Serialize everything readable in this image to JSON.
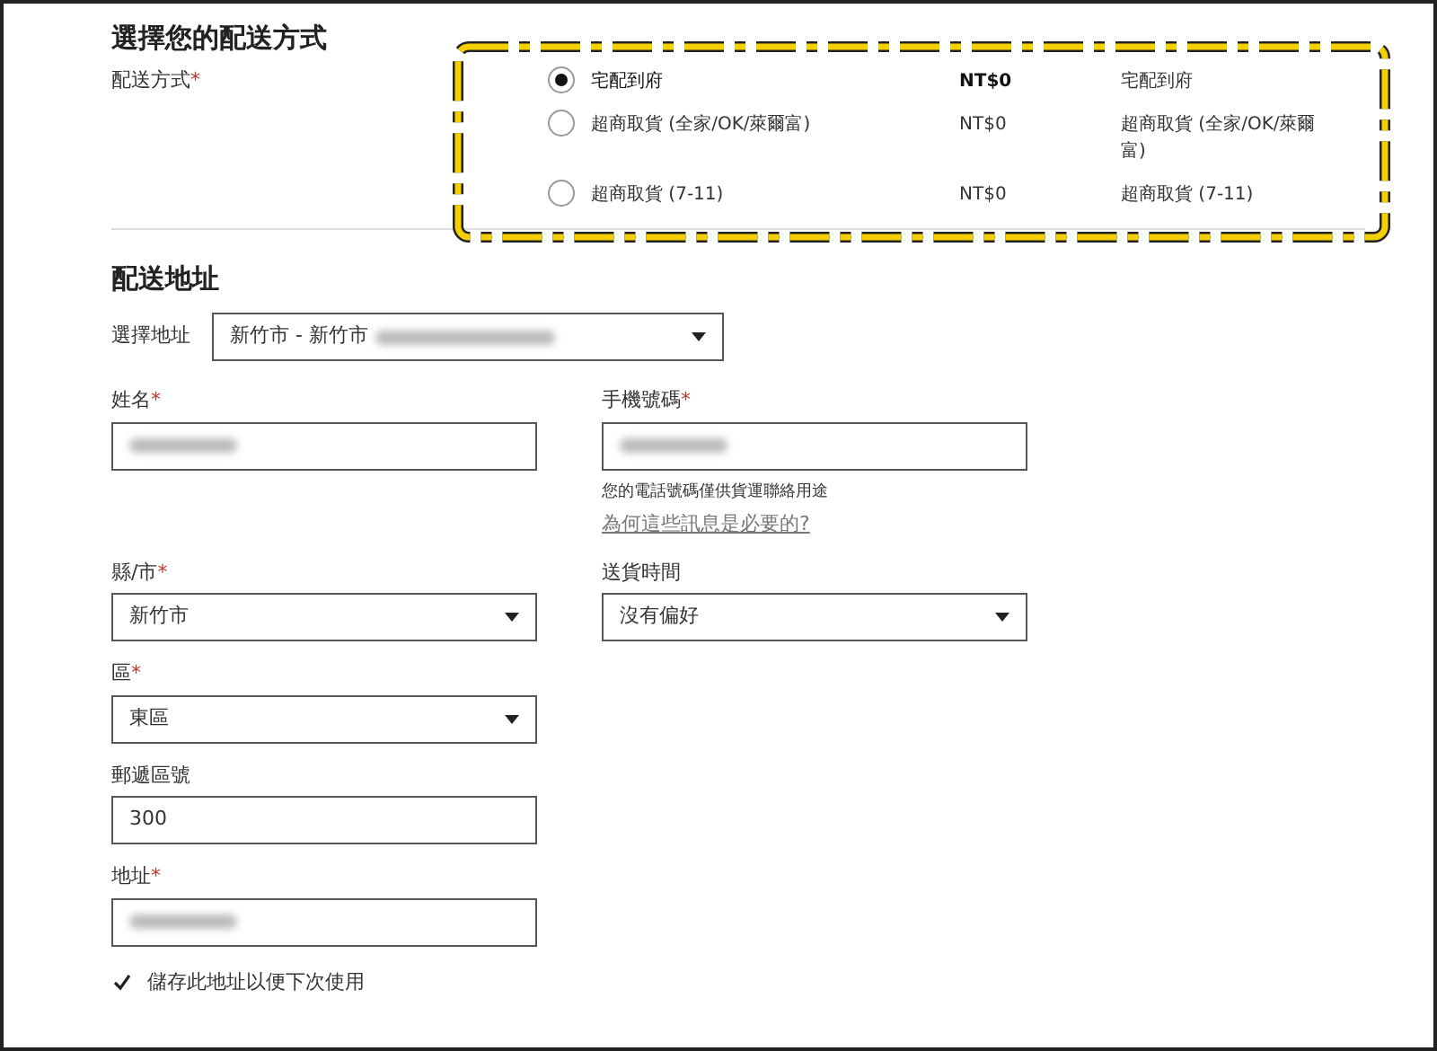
{
  "required_mark": "*",
  "shipping_method": {
    "title": "選擇您的配送方式",
    "label": "配送方式",
    "required": true,
    "options": [
      {
        "name": "宅配到府",
        "price": "NT$0",
        "description": "宅配到府",
        "selected": true
      },
      {
        "name": "超商取貨 (全家/OK/萊爾富)",
        "price": "NT$0",
        "description": "超商取貨 (全家/OK/萊爾富)",
        "selected": false
      },
      {
        "name": "超商取貨 (7-11)",
        "price": "NT$0",
        "description": "超商取貨 (7-11)",
        "selected": false
      }
    ]
  },
  "address": {
    "title": "配送地址",
    "select_label": "選擇地址",
    "select_value": "新竹市 - 新竹市",
    "fields": [
      {
        "kind": "text",
        "label": "姓名",
        "required": true,
        "blurred": true
      },
      {
        "kind": "text",
        "label": "手機號碼",
        "required": true,
        "blurred": true,
        "hint": "您的電話號碼僅供貨運聯絡用途",
        "link": "為何這些訊息是必要的?"
      },
      {
        "kind": "select",
        "label": "縣/市",
        "required": true,
        "value": "新竹市"
      },
      {
        "kind": "select",
        "label": "送貨時間",
        "required": false,
        "value": "沒有偏好"
      },
      {
        "kind": "select",
        "label": "區",
        "required": true,
        "value": "東區"
      },
      {
        "kind": "text",
        "label": "郵遞區號",
        "required": false,
        "value": "300"
      },
      {
        "kind": "text",
        "label": "地址",
        "required": true,
        "blurred": true
      }
    ],
    "save": {
      "label": "儲存此地址以便下次使用",
      "checked": true
    }
  }
}
